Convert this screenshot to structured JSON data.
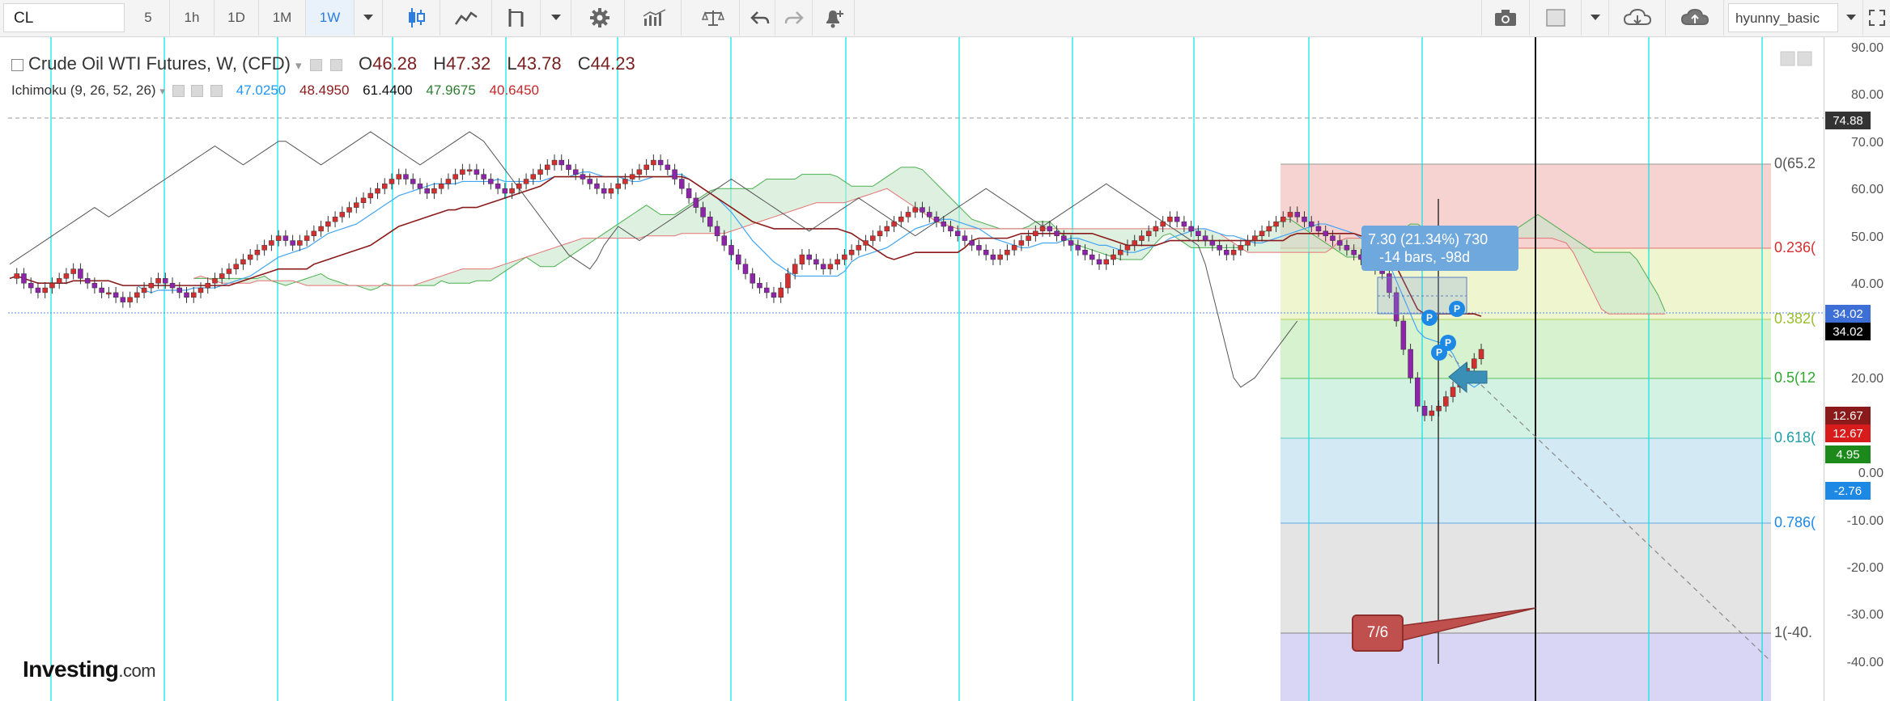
{
  "toolbar": {
    "symbol": "CL",
    "intervals": [
      "5",
      "1h",
      "1D",
      "1M",
      "1W"
    ],
    "active_interval": "1W",
    "user": "hyunny_basic"
  },
  "legend": {
    "title": "Crude Oil WTI Futures, W, (CFD)",
    "open_label": "O",
    "open": "46.28",
    "high_label": "H",
    "high": "47.32",
    "low_label": "L",
    "low": "43.78",
    "close_label": "C",
    "close": "44.23",
    "indicator": "Ichimoku (9, 26, 52, 26)",
    "ind_values": [
      "47.0250",
      "48.4950",
      "61.4400",
      "47.9675",
      "40.6450"
    ],
    "ind_colors": [
      "#2196f3",
      "#8b1a1a",
      "#111111",
      "#2e7d32",
      "#c62828"
    ]
  },
  "price_axis": {
    "ticks": [
      "90.00",
      "80.00",
      "70.00",
      "60.00",
      "50.00",
      "40.00",
      "30.00",
      "20.00",
      "10.00",
      "0.00",
      "-10.00",
      "-20.00",
      "-30.00",
      "-40.00"
    ],
    "tags": [
      {
        "text": "74.88",
        "bg": "#333333"
      },
      {
        "text": "34.02",
        "bg": "#3d6fd6"
      },
      {
        "text": "34.02",
        "bg": "#000000"
      },
      {
        "text": "12.67",
        "bg": "#8b1a1a"
      },
      {
        "text": "12.67",
        "bg": "#d81b1b"
      },
      {
        "text": "4.95",
        "bg": "#1b8a1b"
      },
      {
        "text": "-2.76",
        "bg": "#1e88e5"
      }
    ]
  },
  "fib_levels": [
    {
      "label": "0(65.2",
      "color": "#555555"
    },
    {
      "label": "0.236(",
      "color": "#d32f2f"
    },
    {
      "label": "0.382(",
      "color": "#9abf2c"
    },
    {
      "label": "0.5(12",
      "color": "#2ea82e"
    },
    {
      "label": "0.618(",
      "color": "#1e9fa8"
    },
    {
      "label": "0.786(",
      "color": "#1e88e5"
    },
    {
      "label": "1(-40.",
      "color": "#555555"
    }
  ],
  "measure": {
    "line1": "7.30 (21.34%) 730",
    "line2": "-14 bars, -98d"
  },
  "note": "7/6",
  "logo": {
    "main": "Investing",
    "suffix": ".com"
  },
  "colors": {
    "bull_candle": "#d32f2f",
    "bear_candle": "#8e24aa",
    "cloud_green": "#c8e6c9",
    "cloud_red": "#f8bbd0",
    "vline": "#00e5e5"
  }
}
